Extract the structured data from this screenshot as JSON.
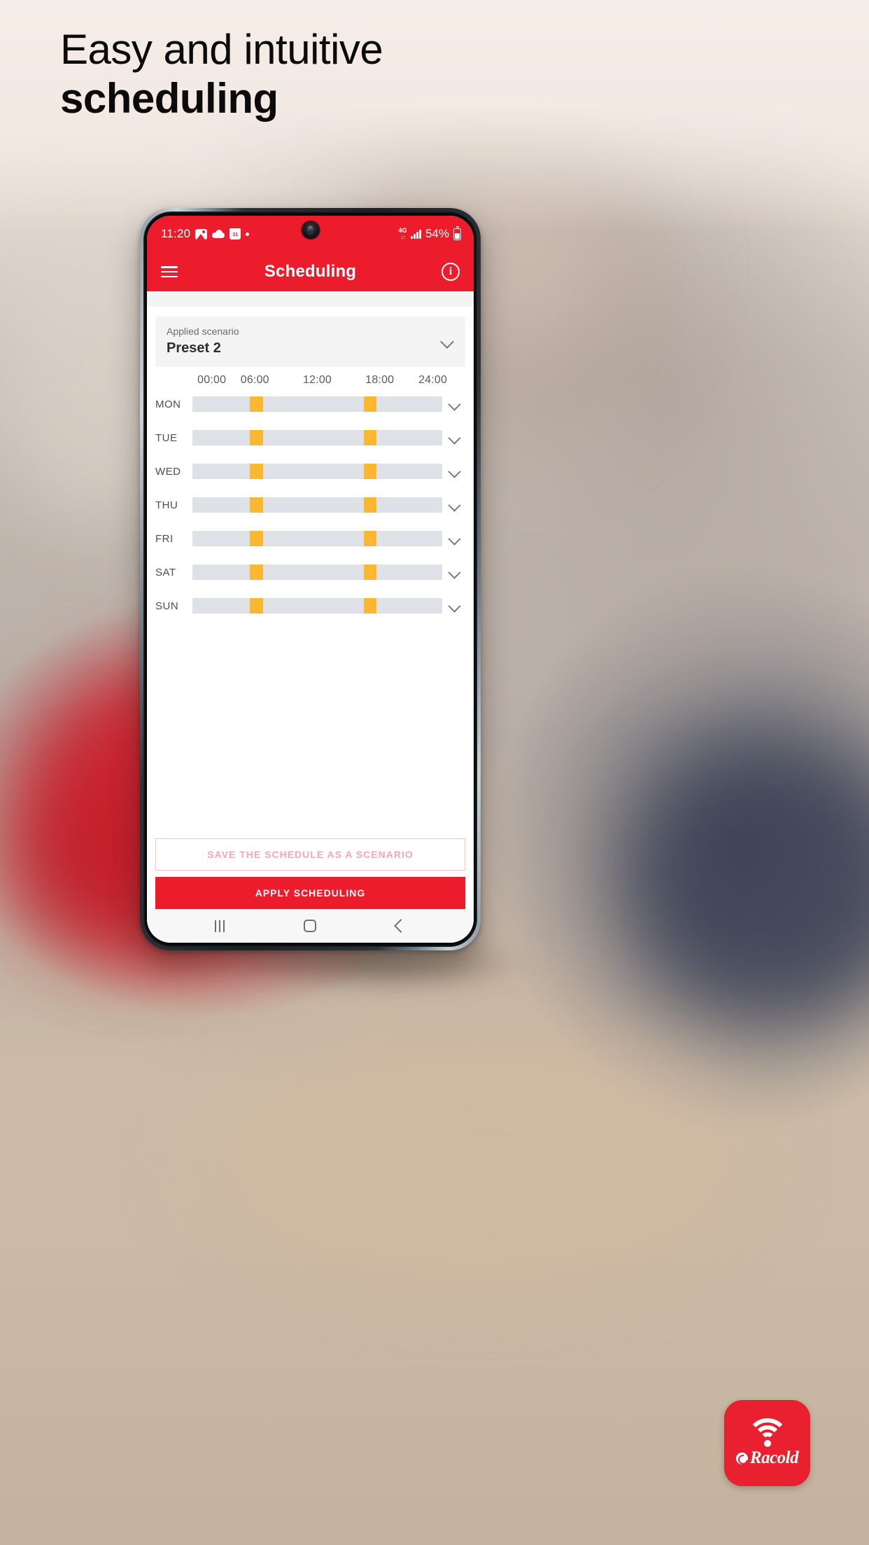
{
  "headline": {
    "line1": "Easy and intuitive",
    "line2": "scheduling"
  },
  "phone": {
    "statusbar": {
      "time": "11:20",
      "icons_left": [
        "gallery-icon",
        "cloud-icon",
        "calendar-icon",
        "dot-icon"
      ],
      "network": "4G",
      "network_sub": "↓↑",
      "battery_percent": "54%",
      "icons_right": [
        "signal-bars-icon",
        "battery-icon"
      ]
    },
    "appbar": {
      "menu_icon": "hamburger-menu-icon",
      "title": "Scheduling",
      "info_icon": "info-icon",
      "info_glyph": "i"
    },
    "scenario": {
      "label": "Applied scenario",
      "value": "Preset 2",
      "chevron_icon": "chevron-down-icon"
    },
    "schedule": {
      "time_ticks": [
        "00:00",
        "06:00",
        "12:00",
        "18:00",
        "24:00"
      ],
      "days": [
        {
          "label": "MON",
          "segments": [
            {
              "start_pct": 23.0,
              "width_pct": 5.2
            },
            {
              "start_pct": 68.5,
              "width_pct": 5.2
            }
          ]
        },
        {
          "label": "TUE",
          "segments": [
            {
              "start_pct": 23.0,
              "width_pct": 5.2
            },
            {
              "start_pct": 68.5,
              "width_pct": 5.2
            }
          ]
        },
        {
          "label": "WED",
          "segments": [
            {
              "start_pct": 23.0,
              "width_pct": 5.2
            },
            {
              "start_pct": 68.5,
              "width_pct": 5.2
            }
          ]
        },
        {
          "label": "THU",
          "segments": [
            {
              "start_pct": 23.0,
              "width_pct": 5.2
            },
            {
              "start_pct": 68.5,
              "width_pct": 5.2
            }
          ]
        },
        {
          "label": "FRI",
          "segments": [
            {
              "start_pct": 23.0,
              "width_pct": 5.2
            },
            {
              "start_pct": 68.5,
              "width_pct": 5.2
            }
          ]
        },
        {
          "label": "SAT",
          "segments": [
            {
              "start_pct": 23.0,
              "width_pct": 5.2
            },
            {
              "start_pct": 68.5,
              "width_pct": 5.2
            }
          ]
        },
        {
          "label": "SUN",
          "segments": [
            {
              "start_pct": 23.0,
              "width_pct": 5.2
            },
            {
              "start_pct": 68.5,
              "width_pct": 5.2
            }
          ]
        }
      ],
      "row_chevron_icon": "chevron-down-icon"
    },
    "actions": {
      "save_label": "SAVE THE SCHEDULE AS A SCENARIO",
      "apply_label": "APPLY SCHEDULING"
    },
    "navbar": {
      "recents_icon": "recents-icon",
      "home_icon": "home-icon",
      "back_icon": "back-icon"
    }
  },
  "badge": {
    "wifi_icon": "wifi-icon",
    "brand_mark_icon": "racold-swirl-icon",
    "brand_name": "Racold"
  },
  "colors": {
    "brand_red": "#ec1c2c",
    "schedule_accent": "#fbb731",
    "track_grey": "#dee1e6",
    "outline_pink": "#f5a8b2"
  }
}
